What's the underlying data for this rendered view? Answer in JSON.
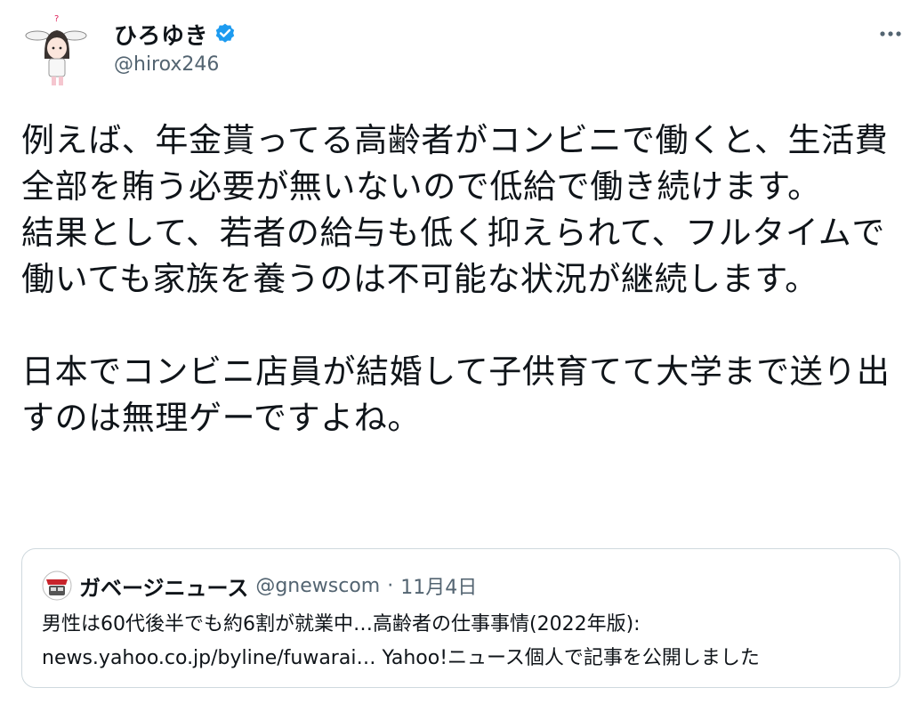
{
  "author": {
    "display_name": "ひろゆき",
    "handle": "@hirox246",
    "verified": true,
    "verified_color": "#1d9bf0"
  },
  "tweet": {
    "text": "例えば、年金貰ってる高齢者がコンビニで働くと、生活費全部を賄う必要が無いないので低給で働き続けます。\n結果として、若者の給与も低く抑えられて、フルタイムで働いても家族を養うのは不可能な状況が継続します。\n\n日本でコンビニ店員が結婚して子供育てて大学まで送り出すのは無理ゲーですよね。"
  },
  "quote": {
    "display_name": "ガベージニュース",
    "handle": "@gnewscom",
    "separator": "·",
    "date": "11月4日",
    "line1": "男性は60代後半でも約6割が就業中…高齢者の仕事事情(2022年版):",
    "line2": "news.yahoo.co.jp/byline/fuwarai… Yahoo!ニュース個人で記事を公開しました"
  },
  "icons": {
    "more": "more-horizontal-icon",
    "verified": "verified-badge-icon"
  },
  "colors": {
    "text": "#0f1419",
    "secondary": "#536471",
    "border": "#cfd9de",
    "accent": "#1d9bf0"
  }
}
